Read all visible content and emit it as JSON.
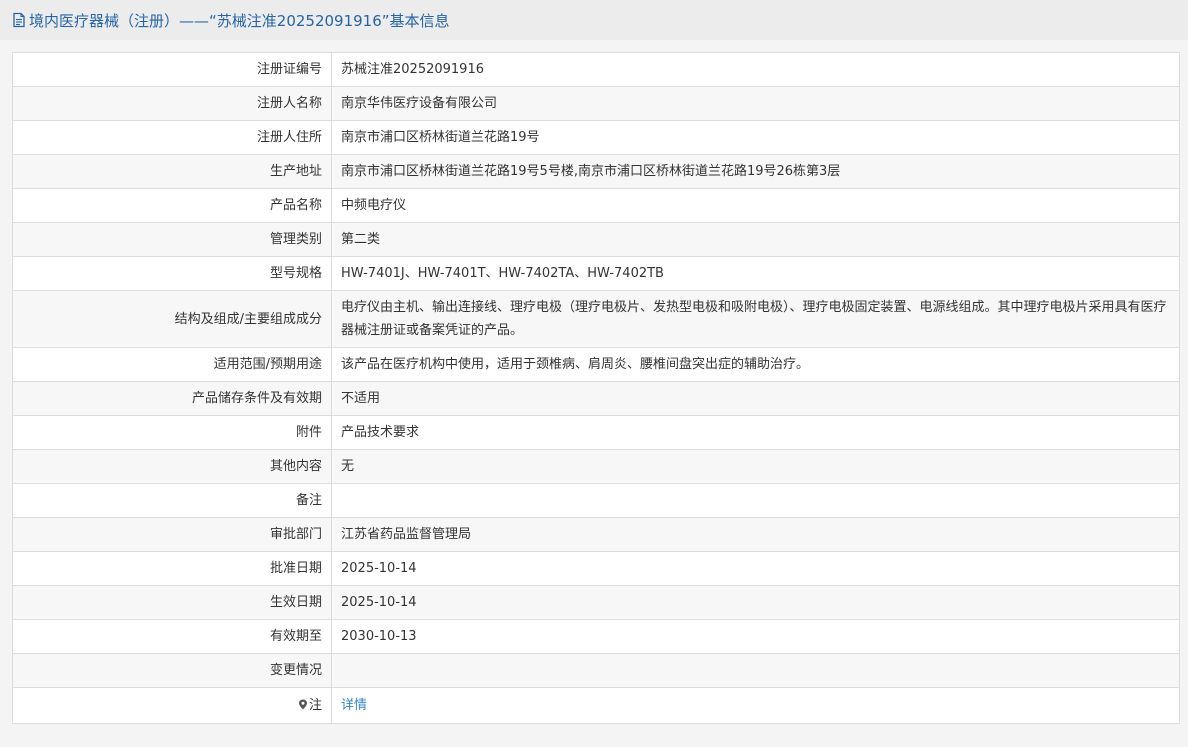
{
  "header": {
    "icon": "document-icon",
    "title": "境内医疗器械（注册）——“苏械注准20252091916”基本信息"
  },
  "rows": [
    {
      "label": "注册证编号",
      "value": "苏械注准20252091916"
    },
    {
      "label": "注册人名称",
      "value": "南京华伟医疗设备有限公司"
    },
    {
      "label": "注册人住所",
      "value": "南京市浦口区桥林街道兰花路19号"
    },
    {
      "label": "生产地址",
      "value": "南京市浦口区桥林街道兰花路19号5号楼,南京市浦口区桥林街道兰花路19号26栋第3层"
    },
    {
      "label": "产品名称",
      "value": "中频电疗仪"
    },
    {
      "label": "管理类别",
      "value": "第二类"
    },
    {
      "label": "型号规格",
      "value": "HW-7401J、HW-7401T、HW-7402TA、HW-7402TB"
    },
    {
      "label": "结构及组成/主要组成成分",
      "value": "电疗仪由主机、输出连接线、理疗电极（理疗电极片、发热型电极和吸附电极）、理疗电极固定装置、电源线组成。其中理疗电极片采用具有医疗器械注册证或备案凭证的产品。"
    },
    {
      "label": "适用范围/预期用途",
      "value": "该产品在医疗机构中使用，适用于颈椎病、肩周炎、腰椎间盘突出症的辅助治疗。"
    },
    {
      "label": "产品储存条件及有效期",
      "value": "不适用"
    },
    {
      "label": "附件",
      "value": "产品技术要求"
    },
    {
      "label": "其他内容",
      "value": "无"
    },
    {
      "label": "备注",
      "value": ""
    },
    {
      "label": "审批部门",
      "value": "江苏省药品监督管理局"
    },
    {
      "label": "批准日期",
      "value": "2025-10-14"
    },
    {
      "label": "生效日期",
      "value": "2025-10-14"
    },
    {
      "label": "有效期至",
      "value": "2030-10-13"
    },
    {
      "label": "变更情况",
      "value": ""
    }
  ],
  "note": {
    "icon": "map-pin-icon",
    "label": "注",
    "link_text": "详情"
  }
}
